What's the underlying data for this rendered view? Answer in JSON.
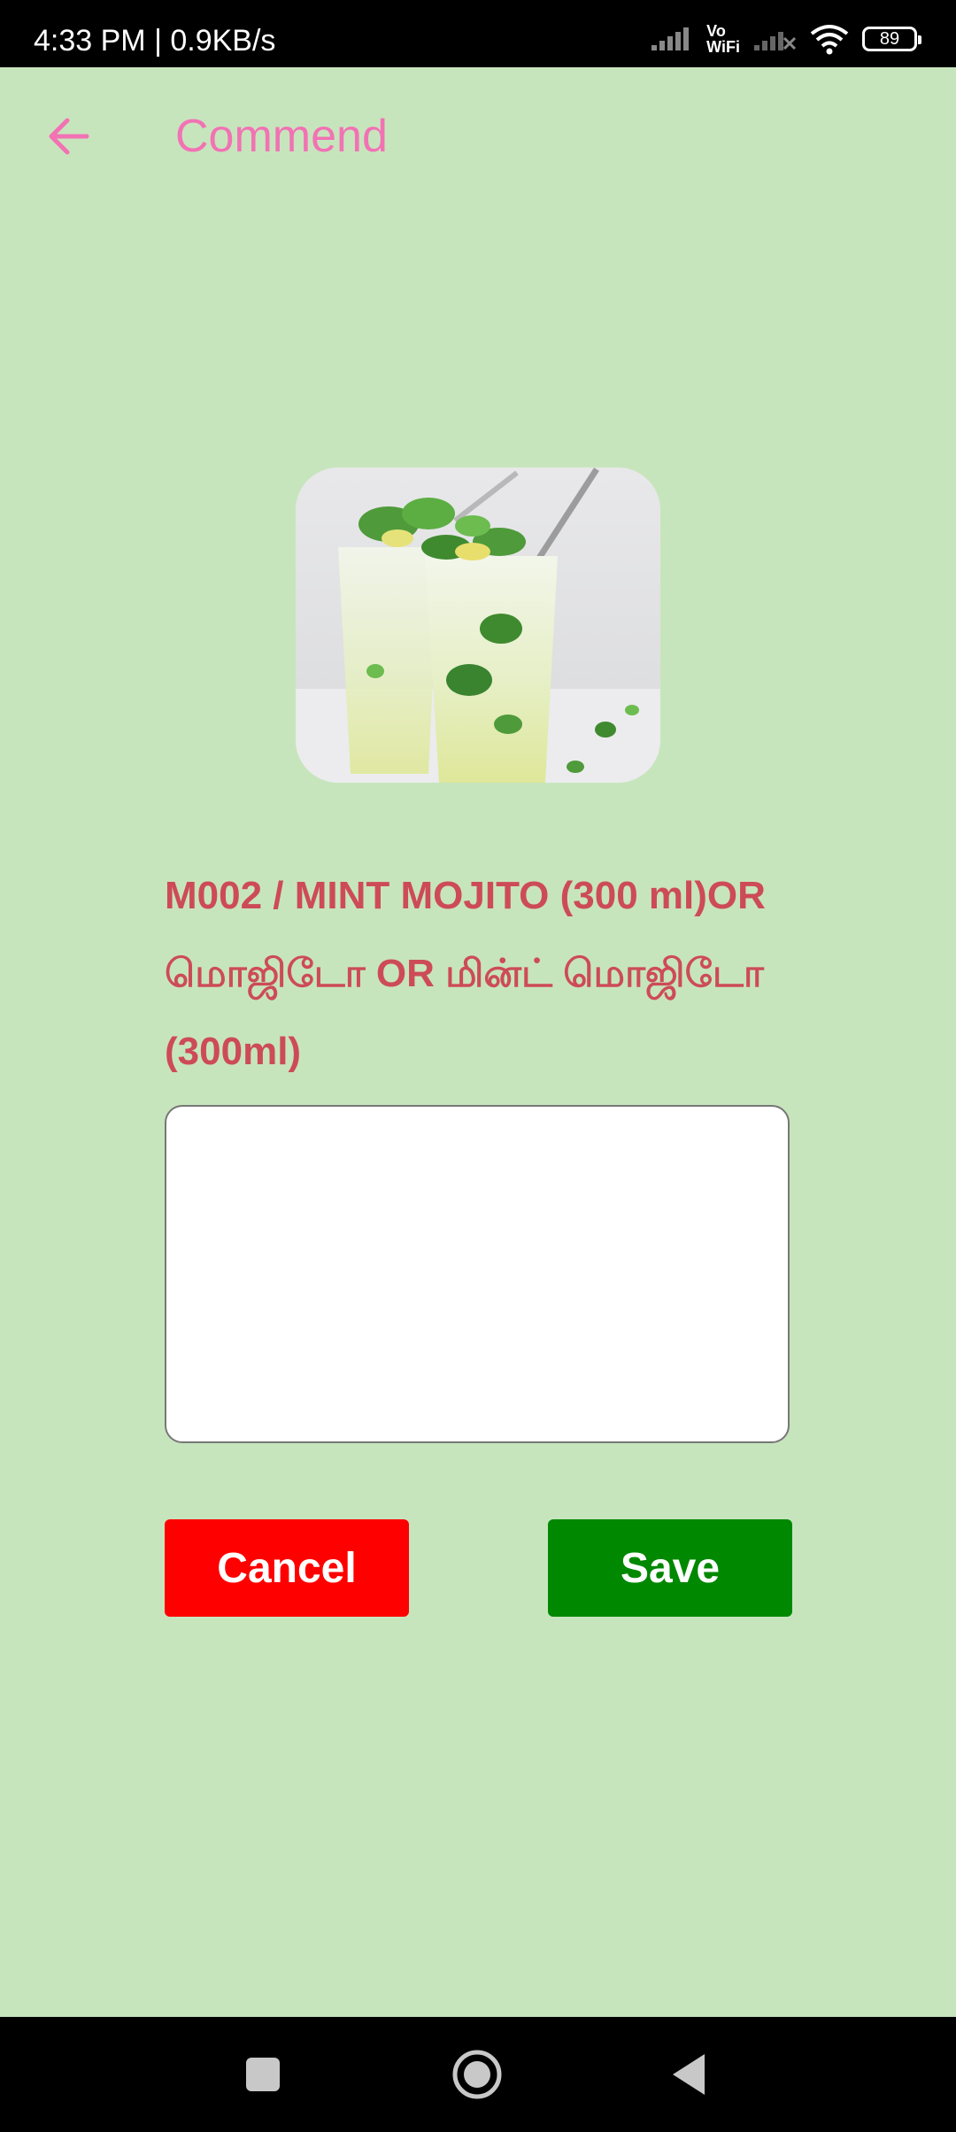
{
  "status_bar": {
    "time": "4:33 PM | 0.9KB/s",
    "vo_line1": "Vo",
    "vo_line2": "WiFi",
    "battery": "89"
  },
  "header": {
    "title": "Commend",
    "back_icon": "arrow-left-icon"
  },
  "item": {
    "title": "M002 / MINT MOJITO (300 ml)OR மொஜிடோ OR மின்ட் மொஜிடோ (300ml)",
    "image": "mint-mojito-photo"
  },
  "comment": {
    "value": "",
    "placeholder": ""
  },
  "actions": {
    "cancel_label": "Cancel",
    "save_label": "Save"
  },
  "colors": {
    "background": "#c7e5bd",
    "accent": "#f272b4",
    "title": "#cd4b57",
    "cancel": "#ff0000",
    "save": "#008800"
  },
  "nav": {
    "items": [
      "recents-square-icon",
      "home-circle-icon",
      "back-triangle-icon"
    ]
  }
}
